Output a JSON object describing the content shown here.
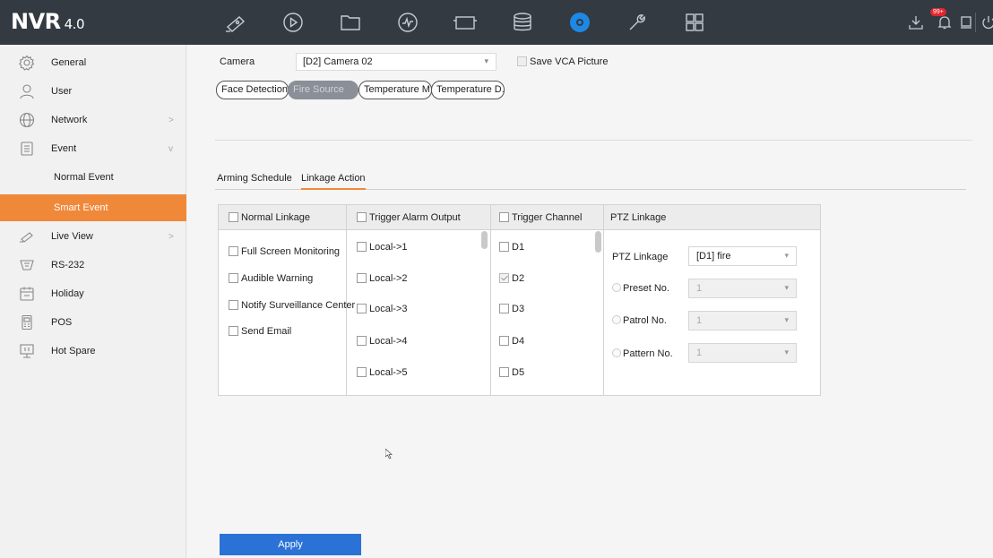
{
  "app": {
    "logo_main": "NVR",
    "logo_version": "4.0",
    "notification_count": "99+"
  },
  "colors": {
    "accent": "#f0883a",
    "topbar": "#333a42",
    "apply": "#2a72d6",
    "active_top_icon": "#1e88e5"
  },
  "top_icons": [
    "live-view-icon",
    "playback-icon",
    "file-icon",
    "vca-icon",
    "camera-icon",
    "storage-icon",
    "config-icon",
    "maintenance-icon",
    "layout-icon",
    "download-icon",
    "alarm-bell-icon",
    "screen-icon",
    "power-icon"
  ],
  "sidebar": {
    "items": [
      {
        "label": "General",
        "icon": "gear-icon",
        "arrow": ""
      },
      {
        "label": "User",
        "icon": "user-icon",
        "arrow": ""
      },
      {
        "label": "Network",
        "icon": "globe-icon",
        "arrow": ">"
      },
      {
        "label": "Event",
        "icon": "event-icon",
        "arrow": "v"
      },
      {
        "label": "Normal Event",
        "icon": "",
        "arrow": ""
      },
      {
        "label": "Smart Event",
        "icon": "",
        "arrow": ""
      },
      {
        "label": "Live View",
        "icon": "camera-icon",
        "arrow": ">"
      },
      {
        "label": "RS-232",
        "icon": "rs232-icon",
        "arrow": ""
      },
      {
        "label": "Holiday",
        "icon": "calendar-icon",
        "arrow": ""
      },
      {
        "label": "POS",
        "icon": "pos-icon",
        "arrow": ""
      },
      {
        "label": "Hot Spare",
        "icon": "hot-spare-icon",
        "arrow": ""
      }
    ]
  },
  "camera": {
    "label": "Camera",
    "value": "[D2] Camera 02",
    "save_vca_label": "Save VCA Picture"
  },
  "detection_tabs": [
    "Face Detection",
    "Fire Source",
    "Temperature M...",
    "Temperature D..."
  ],
  "sub_tabs": [
    "Arming Schedule",
    "Linkage Action"
  ],
  "table": {
    "headers": [
      "Normal Linkage",
      "Trigger Alarm Output",
      "Trigger Channel",
      "PTZ Linkage"
    ],
    "normal_linkage": [
      "Full Screen Monitoring",
      "Audible Warning",
      "Notify Surveillance Center",
      "Send Email"
    ],
    "alarm_outputs": [
      "Local->1",
      "Local->2",
      "Local->3",
      "Local->4",
      "Local->5"
    ],
    "channels": [
      "D1",
      "D2",
      "D3",
      "D4",
      "D5"
    ],
    "ptz": {
      "linkage_label": "PTZ Linkage",
      "linkage_value": "[D1] fire",
      "preset_label": "Preset No.",
      "preset_value": "1",
      "patrol_label": "Patrol No.",
      "patrol_value": "1",
      "pattern_label": "Pattern No.",
      "pattern_value": "1"
    }
  },
  "apply_label": "Apply"
}
